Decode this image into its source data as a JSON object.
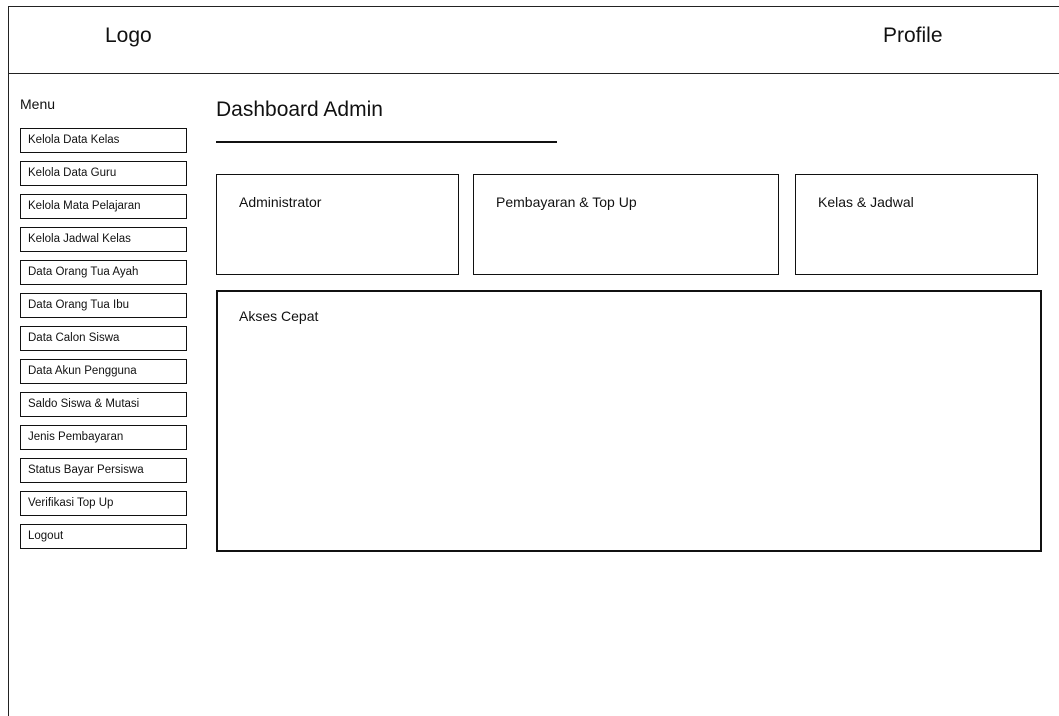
{
  "header": {
    "logo_text": "Logo",
    "profile_text": "Profile"
  },
  "sidebar": {
    "title": "Menu",
    "items": [
      {
        "label": "Kelola Data Kelas"
      },
      {
        "label": "Kelola Data Guru"
      },
      {
        "label": "Kelola Mata Pelajaran"
      },
      {
        "label": "Kelola Jadwal Kelas"
      },
      {
        "label": "Data Orang Tua Ayah"
      },
      {
        "label": "Data Orang Tua Ibu"
      },
      {
        "label": "Data Calon Siswa"
      },
      {
        "label": "Data Akun Pengguna"
      },
      {
        "label": "Saldo Siswa & Mutasi"
      },
      {
        "label": "Jenis Pembayaran"
      },
      {
        "label": "Status Bayar Persiswa"
      },
      {
        "label": "Verifikasi Top Up"
      },
      {
        "label": "Logout"
      }
    ]
  },
  "main": {
    "title": "Dashboard Admin",
    "cards": [
      {
        "label": "Administrator"
      },
      {
        "label": "Pembayaran & Top Up"
      },
      {
        "label": "Kelas & Jadwal"
      }
    ],
    "quick_access": {
      "label": "Akses Cepat"
    }
  }
}
